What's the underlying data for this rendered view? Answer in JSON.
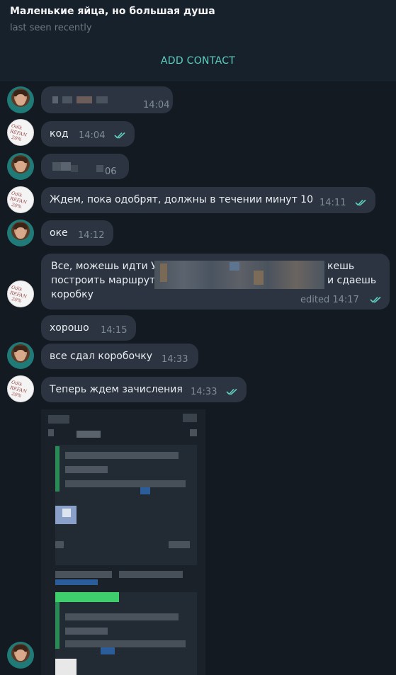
{
  "header": {
    "title": "Маленькие яйца, но большая душа",
    "status": "last seen recently",
    "add_contact": "ADD CONTACT"
  },
  "messages": [
    {
      "sender": "contact",
      "text": "",
      "time": "14:04"
    },
    {
      "sender": "me",
      "text": "код",
      "time": "14:04",
      "read": true
    },
    {
      "sender": "contact",
      "text": "",
      "time": "06"
    },
    {
      "sender": "me",
      "text": "Ждем, пока одобрят, должны в течении минут 10",
      "time": "14:11",
      "read": true
    },
    {
      "sender": "contact",
      "text": "оке",
      "time": "14:12"
    },
    {
      "sender": "me",
      "line1": "Все, можешь идти У",
      "line1_tail": "кешь",
      "line2": "построить маршрут",
      "line2_tail": "и сдаешь",
      "line3": "коробку",
      "time": "edited 14:17",
      "read": true
    },
    {
      "sender": "contact",
      "text": "хорошо",
      "time": "14:15"
    },
    {
      "sender": "contact",
      "text": "все сдал коробочку",
      "time": "14:33"
    },
    {
      "sender": "me",
      "text": "Теперь ждем зачисления",
      "time": "14:33",
      "read": true
    }
  ],
  "colors": {
    "accent": "#5fd0c0",
    "bubble": "#2b3440",
    "background": "#141a21",
    "header": "#17212b"
  },
  "icons": [
    "contact-avatar",
    "logo-avatar",
    "double-check-icon"
  ],
  "logo_text": "Odik REFAN 20%"
}
